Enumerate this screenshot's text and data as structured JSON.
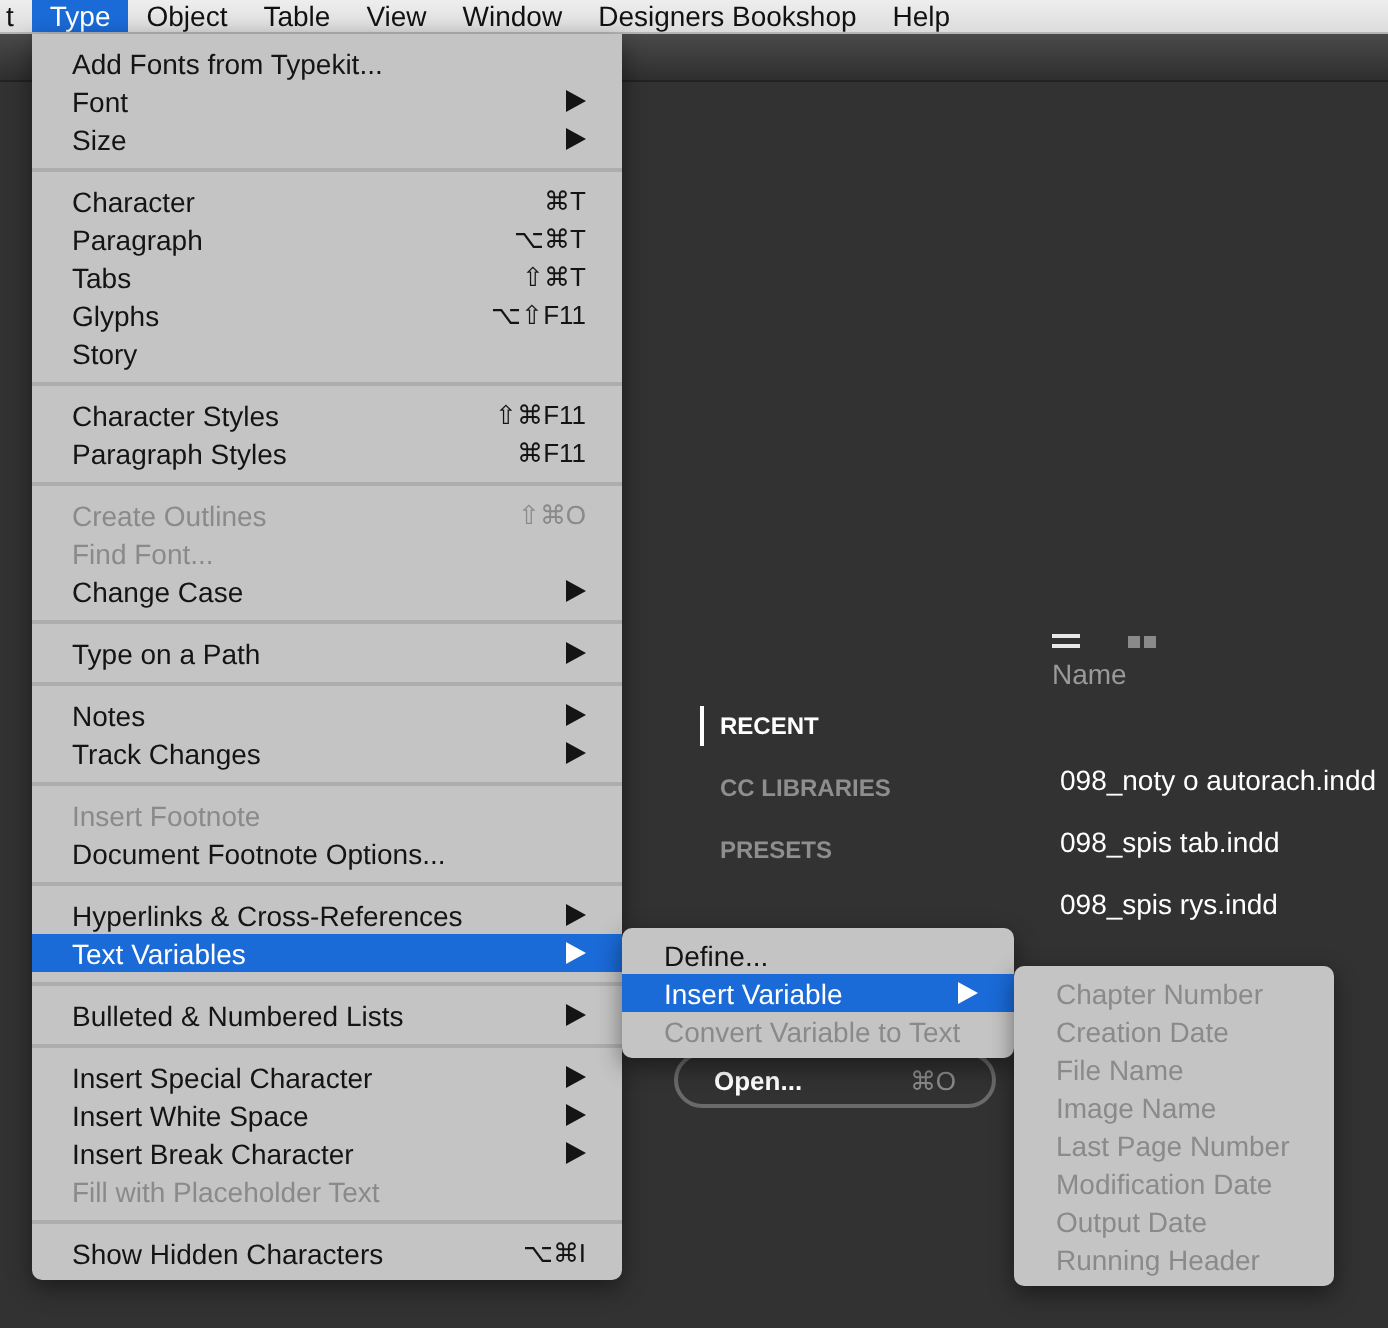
{
  "menubar": [
    {
      "label": "t",
      "selected": false
    },
    {
      "label": "Type",
      "selected": true
    },
    {
      "label": "Object",
      "selected": false
    },
    {
      "label": "Table",
      "selected": false
    },
    {
      "label": "View",
      "selected": false
    },
    {
      "label": "Window",
      "selected": false
    },
    {
      "label": "Designers Bookshop",
      "selected": false
    },
    {
      "label": "Help",
      "selected": false
    }
  ],
  "start_screen": {
    "view_buttons": [
      {
        "kind": "list",
        "selected": true
      },
      {
        "kind": "grid",
        "selected": false
      }
    ],
    "column_header": "Name",
    "sidebar": [
      {
        "label": "RECENT",
        "selected": true
      },
      {
        "label": "CC LIBRARIES",
        "selected": false
      },
      {
        "label": "PRESETS",
        "selected": false
      }
    ],
    "open_button": {
      "label": "Open...",
      "shortcut": "⌘O"
    },
    "files": [
      "098_noty o autorach.indd",
      "098_spis tab.indd",
      "098_spis rys.indd"
    ]
  },
  "type_menu": {
    "groups": [
      [
        {
          "label": "Add Fonts from Typekit...",
          "disabled": false,
          "selected": false,
          "has_submenu": false
        },
        {
          "label": "Font",
          "disabled": false,
          "selected": false,
          "has_submenu": true
        },
        {
          "label": "Size",
          "disabled": false,
          "selected": false,
          "has_submenu": true
        }
      ],
      [
        {
          "label": "Character",
          "shortcut": "⌘T",
          "disabled": false,
          "selected": false,
          "has_submenu": false
        },
        {
          "label": "Paragraph",
          "shortcut": "⌥⌘T",
          "disabled": false,
          "selected": false,
          "has_submenu": false
        },
        {
          "label": "Tabs",
          "shortcut": "⇧⌘T",
          "disabled": false,
          "selected": false,
          "has_submenu": false
        },
        {
          "label": "Glyphs",
          "shortcut": "⌥⇧F11",
          "disabled": false,
          "selected": false,
          "has_submenu": false
        },
        {
          "label": "Story",
          "disabled": false,
          "selected": false,
          "has_submenu": false
        }
      ],
      [
        {
          "label": "Character Styles",
          "shortcut": "⇧⌘F11",
          "disabled": false,
          "selected": false,
          "has_submenu": false
        },
        {
          "label": "Paragraph Styles",
          "shortcut": "⌘F11",
          "disabled": false,
          "selected": false,
          "has_submenu": false
        }
      ],
      [
        {
          "label": "Create Outlines",
          "shortcut": "⇧⌘O",
          "disabled": true,
          "selected": false,
          "has_submenu": false
        },
        {
          "label": "Find Font...",
          "disabled": true,
          "selected": false,
          "has_submenu": false
        },
        {
          "label": "Change Case",
          "disabled": false,
          "selected": false,
          "has_submenu": true
        }
      ],
      [
        {
          "label": "Type on a Path",
          "disabled": false,
          "selected": false,
          "has_submenu": true
        }
      ],
      [
        {
          "label": "Notes",
          "disabled": false,
          "selected": false,
          "has_submenu": true
        },
        {
          "label": "Track Changes",
          "disabled": false,
          "selected": false,
          "has_submenu": true
        }
      ],
      [
        {
          "label": "Insert Footnote",
          "disabled": true,
          "selected": false,
          "has_submenu": false
        },
        {
          "label": "Document Footnote Options...",
          "disabled": false,
          "selected": false,
          "has_submenu": false
        }
      ],
      [
        {
          "label": "Hyperlinks & Cross-References",
          "disabled": false,
          "selected": false,
          "has_submenu": true
        },
        {
          "label": "Text Variables",
          "disabled": false,
          "selected": true,
          "has_submenu": true
        }
      ],
      [
        {
          "label": "Bulleted & Numbered Lists",
          "disabled": false,
          "selected": false,
          "has_submenu": true
        }
      ],
      [
        {
          "label": "Insert Special Character",
          "disabled": false,
          "selected": false,
          "has_submenu": true
        },
        {
          "label": "Insert White Space",
          "disabled": false,
          "selected": false,
          "has_submenu": true
        },
        {
          "label": "Insert Break Character",
          "disabled": false,
          "selected": false,
          "has_submenu": true
        },
        {
          "label": "Fill with Placeholder Text",
          "disabled": true,
          "selected": false,
          "has_submenu": false
        }
      ],
      [
        {
          "label": "Show Hidden Characters",
          "shortcut": "⌥⌘I",
          "disabled": false,
          "selected": false,
          "has_submenu": false
        }
      ]
    ]
  },
  "text_variables_menu": [
    {
      "label": "Define...",
      "disabled": false,
      "selected": false,
      "has_submenu": false
    },
    {
      "label": "Insert Variable",
      "disabled": false,
      "selected": true,
      "has_submenu": true
    },
    {
      "label": "Convert Variable to Text",
      "disabled": true,
      "selected": false,
      "has_submenu": false
    }
  ],
  "insert_variable_menu": [
    {
      "label": "Chapter Number",
      "disabled": true,
      "selected": false,
      "has_submenu": false
    },
    {
      "label": "Creation Date",
      "disabled": true,
      "selected": false,
      "has_submenu": false
    },
    {
      "label": "File Name",
      "disabled": true,
      "selected": false,
      "has_submenu": false
    },
    {
      "label": "Image Name",
      "disabled": true,
      "selected": false,
      "has_submenu": false
    },
    {
      "label": "Last Page Number",
      "disabled": true,
      "selected": false,
      "has_submenu": false
    },
    {
      "label": "Modification Date",
      "disabled": true,
      "selected": false,
      "has_submenu": false
    },
    {
      "label": "Output Date",
      "disabled": true,
      "selected": false,
      "has_submenu": false
    },
    {
      "label": "Running Header",
      "disabled": true,
      "selected": false,
      "has_submenu": false
    }
  ]
}
